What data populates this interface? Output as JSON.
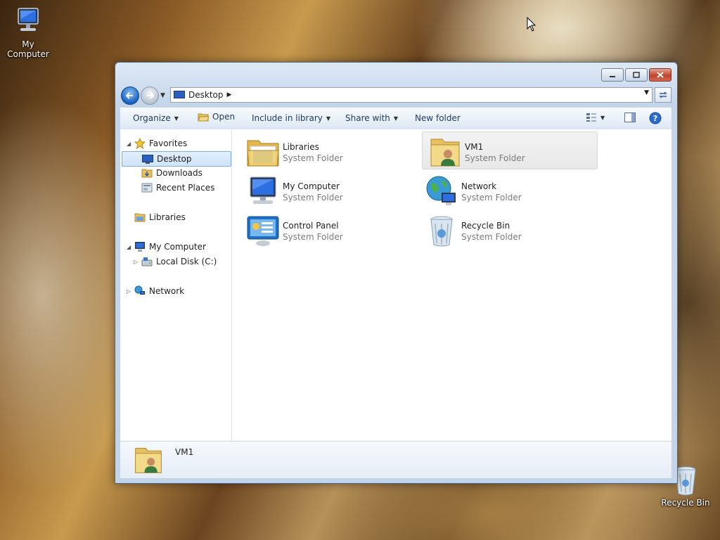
{
  "desktop": {
    "icons": [
      {
        "label": "My Computer",
        "icon": "computer-icon"
      },
      {
        "label": "Recycle Bin",
        "icon": "recycle-bin-icon"
      }
    ]
  },
  "window": {
    "address": {
      "crumb": "Desktop"
    },
    "toolbar": {
      "organize": "Organize",
      "open": "Open",
      "include": "Include in library",
      "share": "Share with",
      "newfolder": "New folder"
    },
    "nav": {
      "favorites": "Favorites",
      "desktop": "Desktop",
      "downloads": "Downloads",
      "recent": "Recent Places",
      "libraries": "Libraries",
      "computer": "My Computer",
      "localdisk": "Local Disk (C:)",
      "network": "Network"
    },
    "items": [
      {
        "name": "Libraries",
        "type": "System Folder"
      },
      {
        "name": "VM1",
        "type": "System Folder"
      },
      {
        "name": "My Computer",
        "type": "System Folder"
      },
      {
        "name": "Network",
        "type": "System Folder"
      },
      {
        "name": "Control Panel",
        "type": "System Folder"
      },
      {
        "name": "Recycle Bin",
        "type": "System Folder"
      }
    ],
    "details": {
      "name": "VM1"
    }
  },
  "colors": {
    "selection": "#cfe3fa",
    "toolbar_text": "#1e395b",
    "close_button": "#c0432c"
  }
}
